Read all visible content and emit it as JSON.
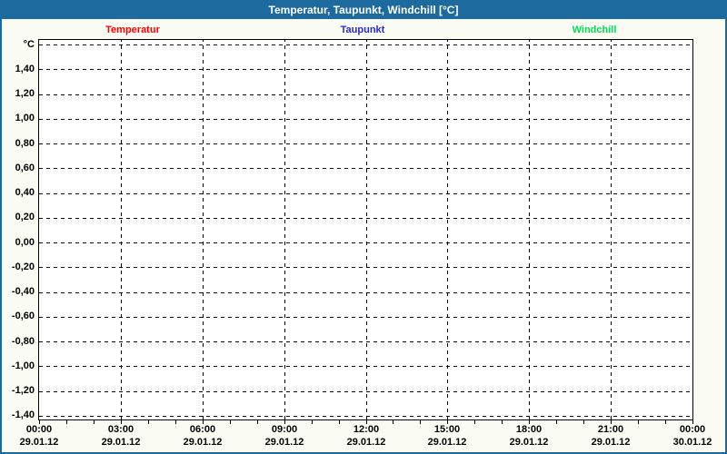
{
  "chart_data": {
    "type": "line",
    "title": "Temperatur, Taupunkt, Windchill [°C]",
    "y_axis": {
      "unit_label": "°C",
      "tick_labels": [
        "1,40",
        "1,20",
        "1,00",
        "0,80",
        "0,60",
        "0,40",
        "0,20",
        "0,00",
        "-0,20",
        "-0,40",
        "-0,60",
        "-0,80",
        "-1,00",
        "-1,20",
        "-1,40"
      ],
      "tick_step": 0.2,
      "top_gridline_value": 1.6,
      "bottom_gridline_value": -1.4,
      "grid_style": "dashed"
    },
    "x_axis": {
      "span_hours": 24,
      "major_tick_interval_hours": 3,
      "minor_tick_interval_hours": 1,
      "major_tick_labels": [
        {
          "time": "00:00",
          "date": "29.01.12"
        },
        {
          "time": "03:00",
          "date": "29.01.12"
        },
        {
          "time": "06:00",
          "date": "29.01.12"
        },
        {
          "time": "09:00",
          "date": "29.01.12"
        },
        {
          "time": "12:00",
          "date": "29.01.12"
        },
        {
          "time": "15:00",
          "date": "29.01.12"
        },
        {
          "time": "18:00",
          "date": "29.01.12"
        },
        {
          "time": "21:00",
          "date": "29.01.12"
        },
        {
          "time": "00:00",
          "date": "30.01.12"
        }
      ],
      "grid_style": "dashed"
    },
    "series": [
      {
        "name": "Temperatur",
        "color": "#ff0000",
        "values": []
      },
      {
        "name": "Taupunkt",
        "color": "#2929d6",
        "values": []
      },
      {
        "name": "Windchill",
        "color": "#00dd55",
        "values": []
      }
    ],
    "plot_is_empty": true,
    "legend_position": "top"
  },
  "colors": {
    "frame": "#1d6a9e",
    "title_text": "#ffffff",
    "axis": "#000000",
    "plot_background": "#ffffff",
    "page_background": "#fbfcf4"
  }
}
